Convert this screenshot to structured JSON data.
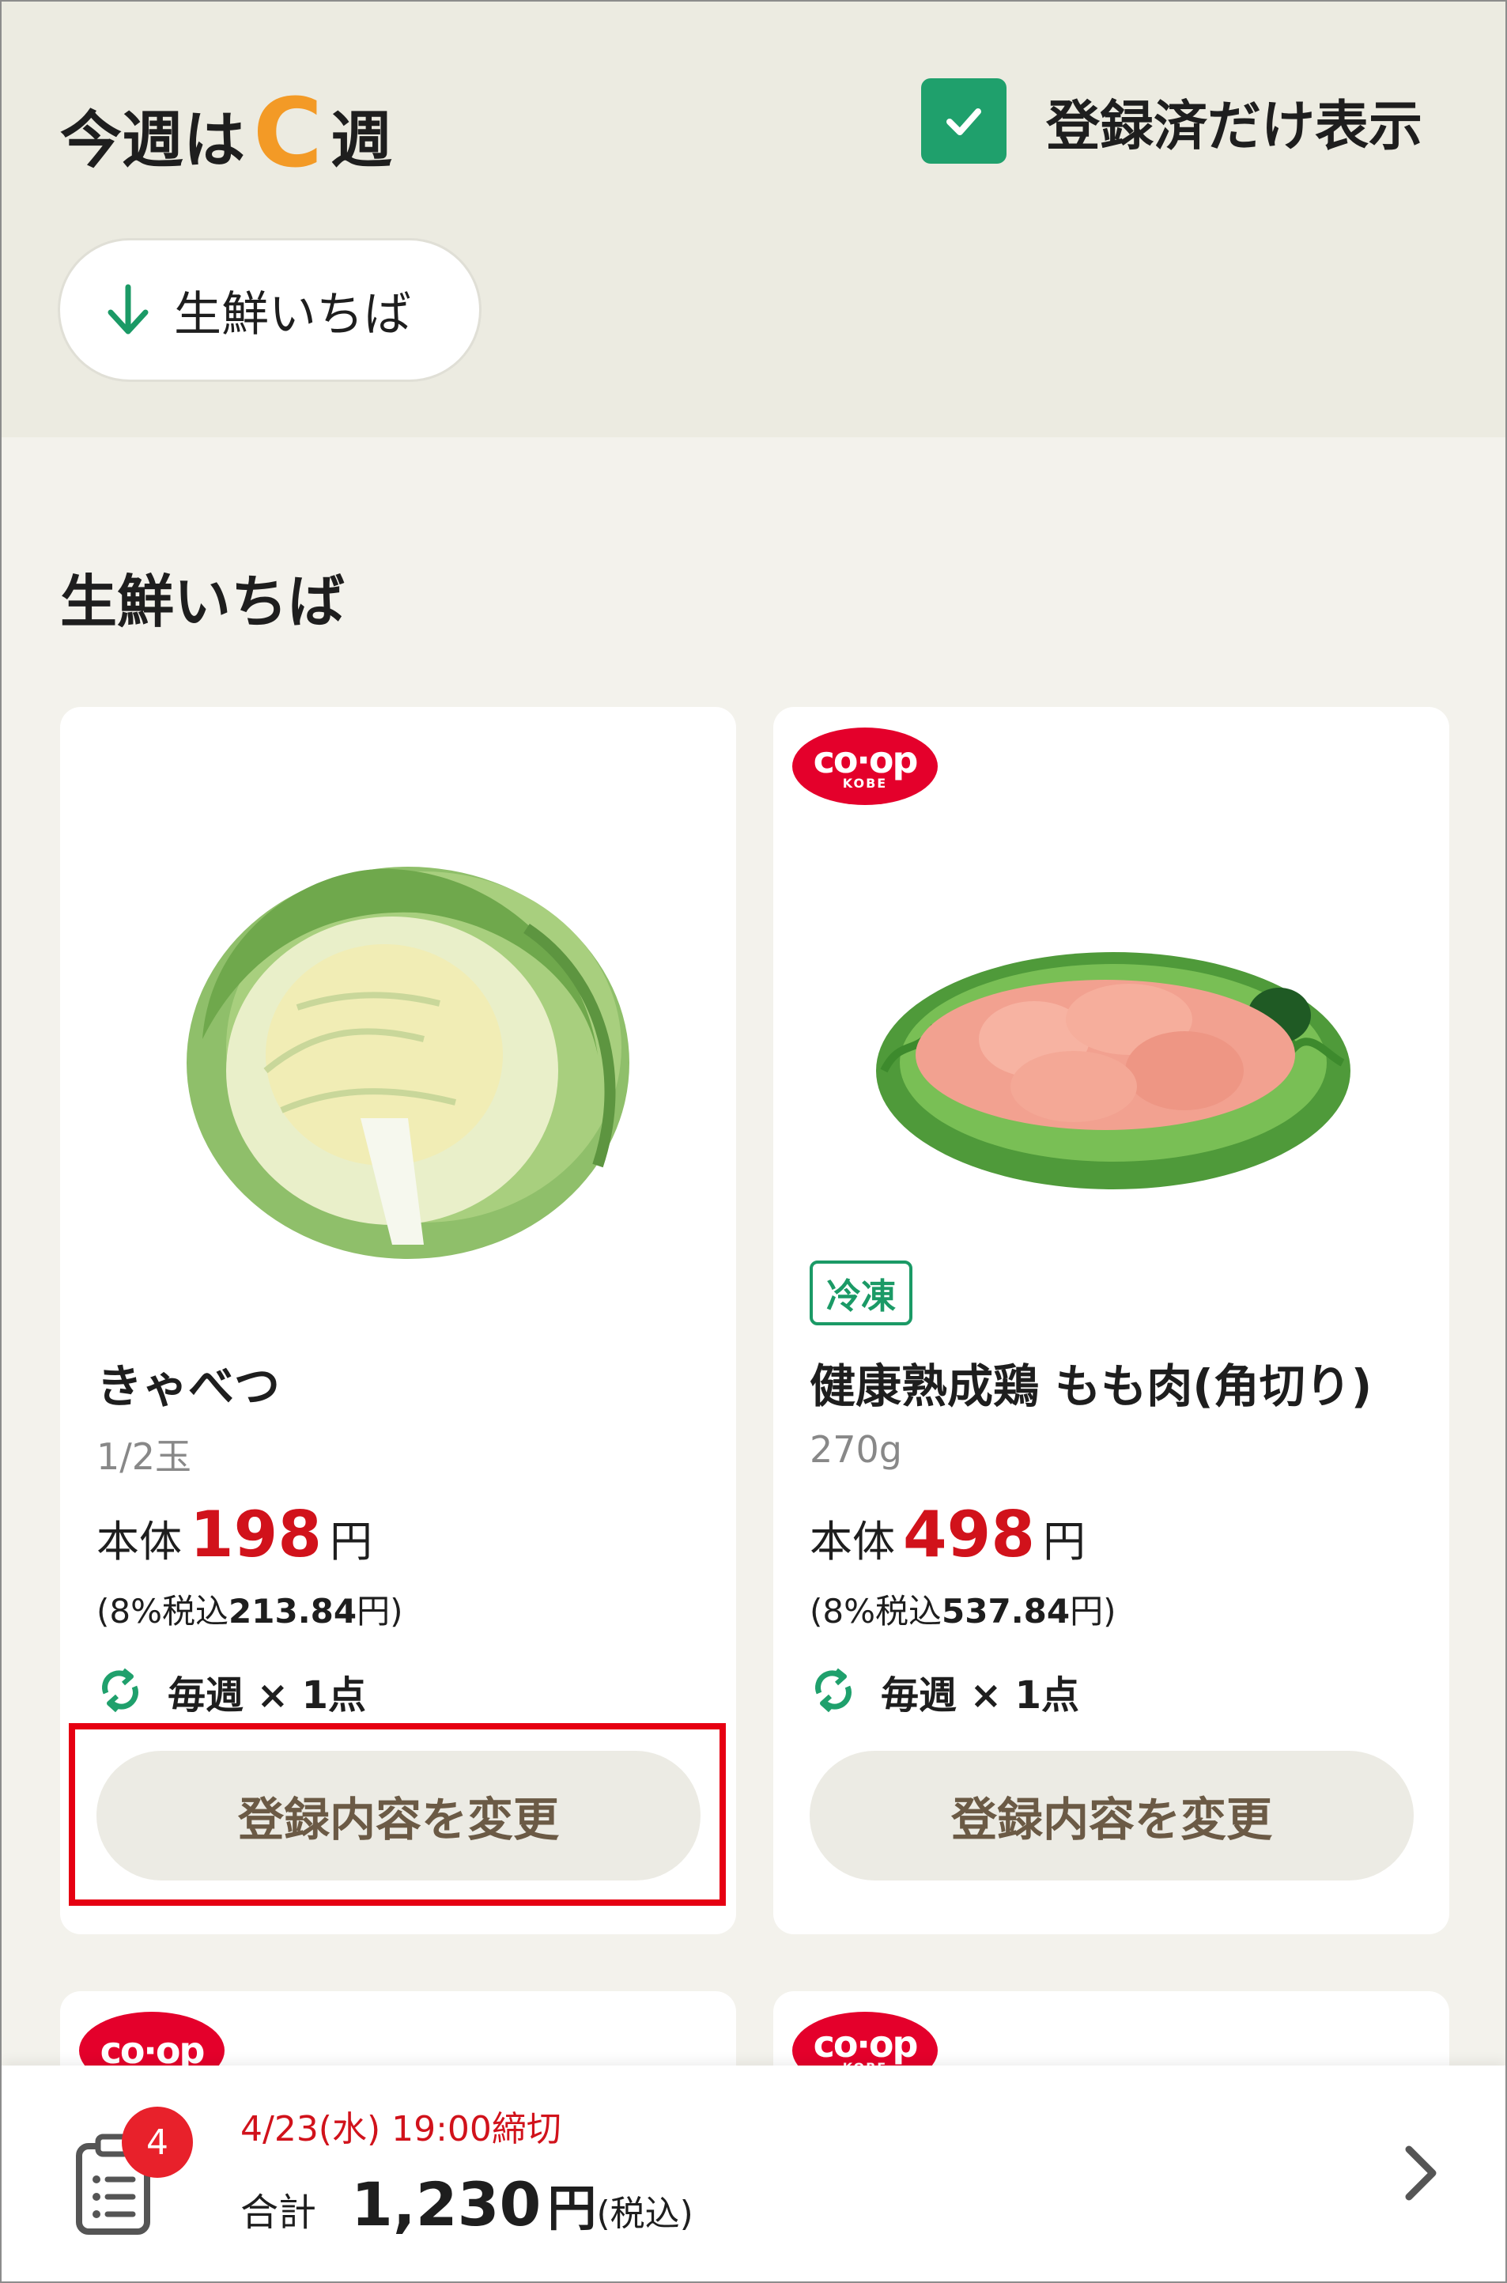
{
  "header": {
    "week_prefix": "今週は",
    "week_letter": "C",
    "week_suffix": "週",
    "registered_only_label": "登録済だけ表示",
    "registered_only_checked": true,
    "category_chip": "生鮮いちば"
  },
  "section": {
    "title": "生鮮いちば"
  },
  "products": [
    {
      "name": "きゃべつ",
      "quantity": "1/2玉",
      "price_label": "本体",
      "price": "198",
      "yen": "円",
      "tax_prefix": "(8%税込",
      "tax_price": "213.84",
      "tax_suffix": "円)",
      "frequency": "毎週 × 1点",
      "button": "登録内容を変更"
    },
    {
      "brand": "co·op",
      "brand_city": "KOBE",
      "tag": "冷凍",
      "name": "健康熟成鶏 もも肉(角切り)",
      "quantity": "270g",
      "price_label": "本体",
      "price": "498",
      "yen": "円",
      "tax_prefix": "(8%税込",
      "tax_price": "537.84",
      "tax_suffix": "円)",
      "frequency": "毎週 × 1点",
      "button": "登録内容を変更"
    }
  ],
  "partial_cards": [
    {
      "brand": "co·op"
    },
    {
      "brand": "co·op",
      "brand_city": "KOBE"
    }
  ],
  "footer": {
    "badge_count": "4",
    "deadline": "4/23(水) 19:00締切",
    "total_label": "合計",
    "total_amount": "1,230",
    "total_yen": "円",
    "total_tax_note": "(税込)"
  },
  "colors": {
    "accent_orange": "#f39a26",
    "green": "#1fa06c",
    "price_red": "#d1121b",
    "highlight_red": "#e60012",
    "coop_red": "#e4002b"
  }
}
